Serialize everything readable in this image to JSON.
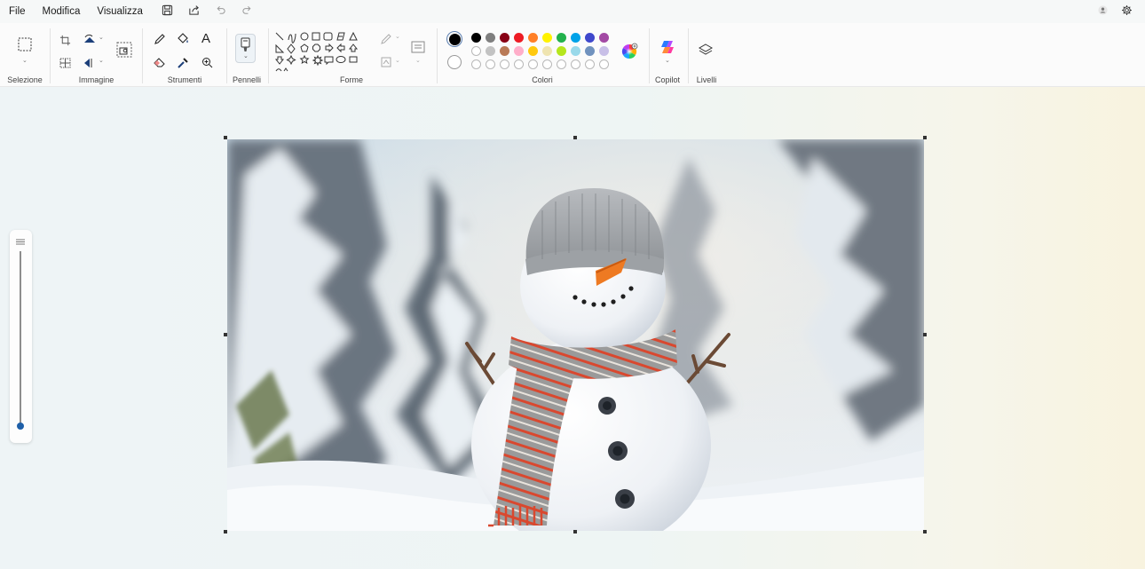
{
  "menu": {
    "items": [
      "File",
      "Modifica",
      "Visualizza"
    ]
  },
  "ribbon": {
    "groups": {
      "selection": "Selezione",
      "image": "Immagine",
      "tools": "Strumenti",
      "brushes": "Pennelli",
      "shapes": "Forme",
      "colors": "Colori",
      "copilot": "Copilot",
      "layers": "Livelli"
    },
    "tools_text_icon": "A"
  },
  "colors": {
    "primary": "#000000",
    "secondary": "#ffffff",
    "palette_row1": [
      "#000000",
      "#7f7f7f",
      "#880015",
      "#ed1c24",
      "#ff7f27",
      "#fff200",
      "#22b14c",
      "#00a2e8",
      "#3f48cc",
      "#a349a4"
    ],
    "palette_row2": [
      "#ffffff",
      "#c3c3c3",
      "#b97a57",
      "#ffaec9",
      "#ffc90e",
      "#efe4b0",
      "#b5e61d",
      "#99d9ea",
      "#7092be",
      "#c8bfe7"
    ]
  },
  "canvas": {
    "image": "snowman photo"
  }
}
